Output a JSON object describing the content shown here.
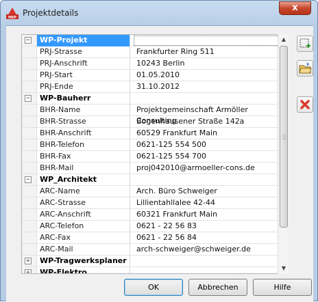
{
  "window": {
    "title": "Projektdetails",
    "close_glyph": "x"
  },
  "grid": {
    "rows": [
      {
        "type": "category",
        "label": "WP-Projekt",
        "toggle": "−",
        "value": "",
        "selected": true
      },
      {
        "type": "prop",
        "label": "PRJ-Strasse",
        "value": "Frankfurter Ring 511"
      },
      {
        "type": "prop",
        "label": "PRJ-Anschrift",
        "value": "10243 Berlin"
      },
      {
        "type": "prop",
        "label": "PRJ-Start",
        "value": "01.05.2010"
      },
      {
        "type": "prop",
        "label": "PRJ-Ende",
        "value": "31.10.2012"
      },
      {
        "type": "category",
        "label": "WP-Bauherr",
        "toggle": "−",
        "value": ""
      },
      {
        "type": "prop",
        "label": "BHR-Name",
        "value": "Projektgemeinschaft Armöller Consulting"
      },
      {
        "type": "prop",
        "label": "BHR-Strasse",
        "value": "Bogenhausener Straße 142a"
      },
      {
        "type": "prop",
        "label": "BHR-Anschrift",
        "value": "60529 Frankfurt Main"
      },
      {
        "type": "prop",
        "label": "BHR-Telefon",
        "value": "0621-125 554 500"
      },
      {
        "type": "prop",
        "label": "BHR-Fax",
        "value": "0621-125 554 700"
      },
      {
        "type": "prop",
        "label": "BHR-Mail",
        "value": "proj042010@armoeller-cons.de"
      },
      {
        "type": "category",
        "label": "WP_Architekt",
        "toggle": "−",
        "value": ""
      },
      {
        "type": "prop",
        "label": "ARC-Name",
        "value": "Arch. Büro Schweiger"
      },
      {
        "type": "prop",
        "label": "ARC-Strasse",
        "value": "Lillientahllalee 42-44"
      },
      {
        "type": "prop",
        "label": "ARC-Anschrift",
        "value": "60321 Frankfurt Main"
      },
      {
        "type": "prop",
        "label": "ARC-Telefon",
        "value": "0621 - 22 56 83"
      },
      {
        "type": "prop",
        "label": "ARC-Fax",
        "value": "0621 - 22 56 84"
      },
      {
        "type": "prop",
        "label": "ARC-Mail",
        "value": "arch-schweiger@schweiger.de"
      },
      {
        "type": "category",
        "label": "WP-Tragwerksplaner",
        "toggle": "+",
        "value": ""
      },
      {
        "type": "category",
        "label": "WP-Elektro",
        "toggle": "+",
        "value": ""
      }
    ]
  },
  "scrollbar": {
    "up_glyph": "▲",
    "down_glyph": "▼",
    "position": 0.0
  },
  "side_buttons": [
    {
      "icon": "new-item-icon"
    },
    {
      "icon": "open-folder-icon"
    },
    {
      "icon": "delete-icon"
    }
  ],
  "buttons": {
    "ok": "OK",
    "cancel": "Abbrechen",
    "help": "Hilfe"
  },
  "colors": {
    "selection": "#3399ff",
    "close": "#c6472c",
    "delete": "#d83a2a"
  }
}
